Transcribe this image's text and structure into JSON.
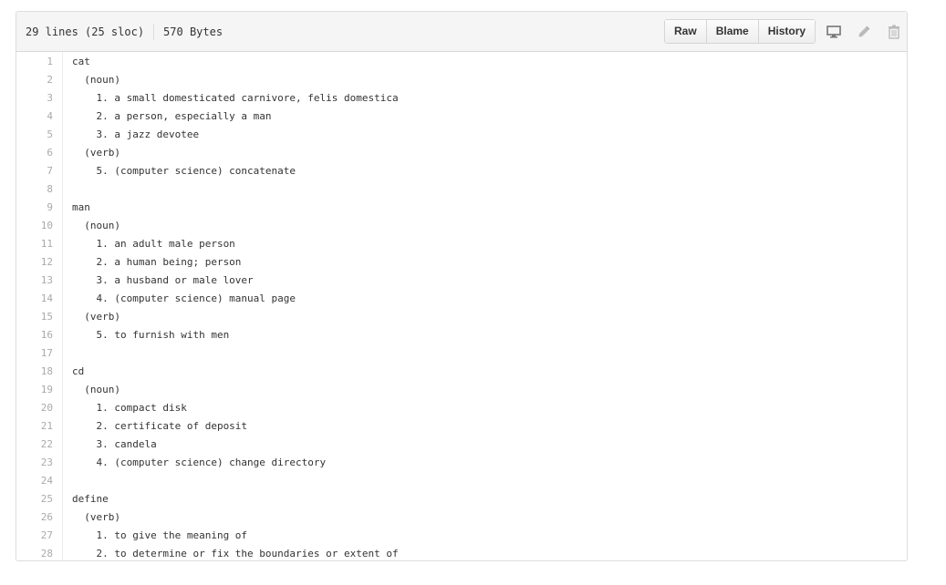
{
  "header": {
    "lines_info": "29 lines (25 sloc)",
    "size_info": "570 Bytes",
    "buttons": {
      "raw": "Raw",
      "blame": "Blame",
      "history": "History"
    },
    "icons": [
      "desktop-icon",
      "pencil-icon",
      "trash-icon"
    ]
  },
  "code": {
    "lines": [
      {
        "n": "1",
        "t": "cat"
      },
      {
        "n": "2",
        "t": "  (noun)"
      },
      {
        "n": "3",
        "t": "    1. a small domesticated carnivore, felis domestica"
      },
      {
        "n": "4",
        "t": "    2. a person, especially a man"
      },
      {
        "n": "5",
        "t": "    3. a jazz devotee"
      },
      {
        "n": "6",
        "t": "  (verb)"
      },
      {
        "n": "7",
        "t": "    5. (computer science) concatenate"
      },
      {
        "n": "8",
        "t": ""
      },
      {
        "n": "9",
        "t": "man"
      },
      {
        "n": "10",
        "t": "  (noun)"
      },
      {
        "n": "11",
        "t": "    1. an adult male person"
      },
      {
        "n": "12",
        "t": "    2. a human being; person"
      },
      {
        "n": "13",
        "t": "    3. a husband or male lover"
      },
      {
        "n": "14",
        "t": "    4. (computer science) manual page"
      },
      {
        "n": "15",
        "t": "  (verb)"
      },
      {
        "n": "16",
        "t": "    5. to furnish with men"
      },
      {
        "n": "17",
        "t": ""
      },
      {
        "n": "18",
        "t": "cd"
      },
      {
        "n": "19",
        "t": "  (noun)"
      },
      {
        "n": "20",
        "t": "    1. compact disk"
      },
      {
        "n": "21",
        "t": "    2. certificate of deposit"
      },
      {
        "n": "22",
        "t": "    3. candela"
      },
      {
        "n": "23",
        "t": "    4. (computer science) change directory"
      },
      {
        "n": "24",
        "t": ""
      },
      {
        "n": "25",
        "t": "define"
      },
      {
        "n": "26",
        "t": "  (verb)"
      },
      {
        "n": "27",
        "t": "    1. to give the meaning of"
      },
      {
        "n": "28",
        "t": "    2. to determine or fix the boundaries or extent of"
      }
    ]
  }
}
